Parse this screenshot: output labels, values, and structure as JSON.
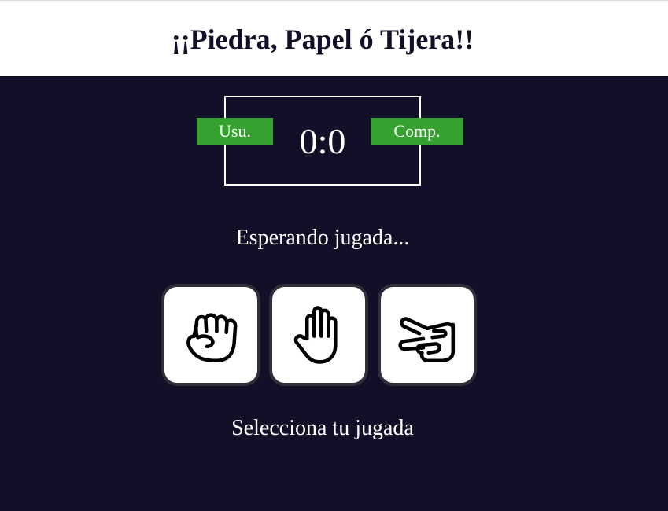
{
  "header": {
    "title": "¡¡Piedra, Papel ó Tijera!!"
  },
  "scoreboard": {
    "score": "0:0",
    "user_label": "Usu.",
    "computer_label": "Comp."
  },
  "status": "Esperando jugada...",
  "choices": [
    {
      "icon": "rock-fist-icon"
    },
    {
      "icon": "paper-hand-icon"
    },
    {
      "icon": "scissors-hand-icon"
    }
  ],
  "hint": "Selecciona tu jugada",
  "colors": {
    "background": "#121028",
    "header_bg": "#ffffff",
    "badge_green": "#35a12e",
    "button_border": "#2f2f3a"
  }
}
